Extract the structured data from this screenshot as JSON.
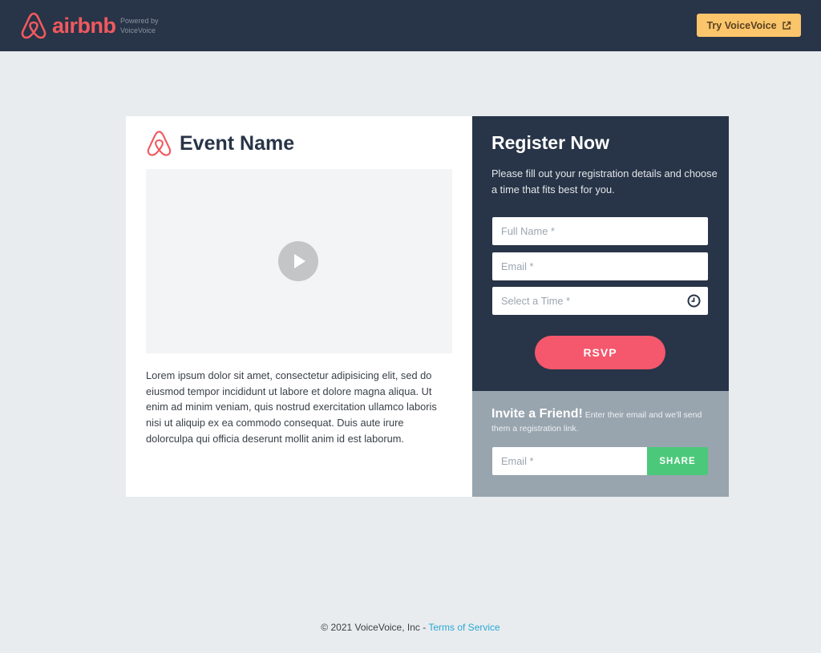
{
  "header": {
    "brand_name": "airbnb",
    "powered_by_line1": "Powered by",
    "powered_by_line2": "VoiceVoice",
    "try_button_label": "Try VoiceVoice",
    "try_button_icon": "external-link-icon",
    "colors": {
      "bar": "#283447",
      "brand": "#f1595f",
      "try_button": "#fbc56b"
    }
  },
  "event": {
    "title": "Event Name",
    "logo_icon": "airbnb-logo-icon",
    "video_icon": "play-icon",
    "description": "Lorem ipsum dolor sit amet, consectetur adipisicing elit, sed do eiusmod tempor incididunt ut labore et dolore magna aliqua. Ut enim ad minim veniam, quis nostrud exercitation ullamco laboris nisi ut aliquip ex ea commodo consequat. Duis aute irure dolorculpa qui officia deserunt mollit anim id est laborum."
  },
  "register": {
    "title": "Register Now",
    "subtitle": "Please fill out your registration details and choose a time that fits best for you.",
    "fields": {
      "full_name": {
        "placeholder": "Full Name *",
        "value": ""
      },
      "email": {
        "placeholder": "Email *",
        "value": ""
      },
      "time": {
        "placeholder": "Select a Time *",
        "value": "",
        "icon": "clock-icon"
      }
    },
    "rsvp_label": "RSVP",
    "colors": {
      "panel": "#283447",
      "rsvp": "#f5576c"
    }
  },
  "invite": {
    "heading": "Invite a Friend!",
    "text": "Enter their email and we'll send them a registration link.",
    "email_placeholder": "Email *",
    "email_value": "",
    "share_label": "SHARE",
    "colors": {
      "panel": "#98a4ae",
      "share": "#4cc87a"
    }
  },
  "footer": {
    "copyright": "© 2021 VoiceVoice, Inc - ",
    "terms_label": "Terms of Service",
    "link_color": "#29a8d4"
  }
}
